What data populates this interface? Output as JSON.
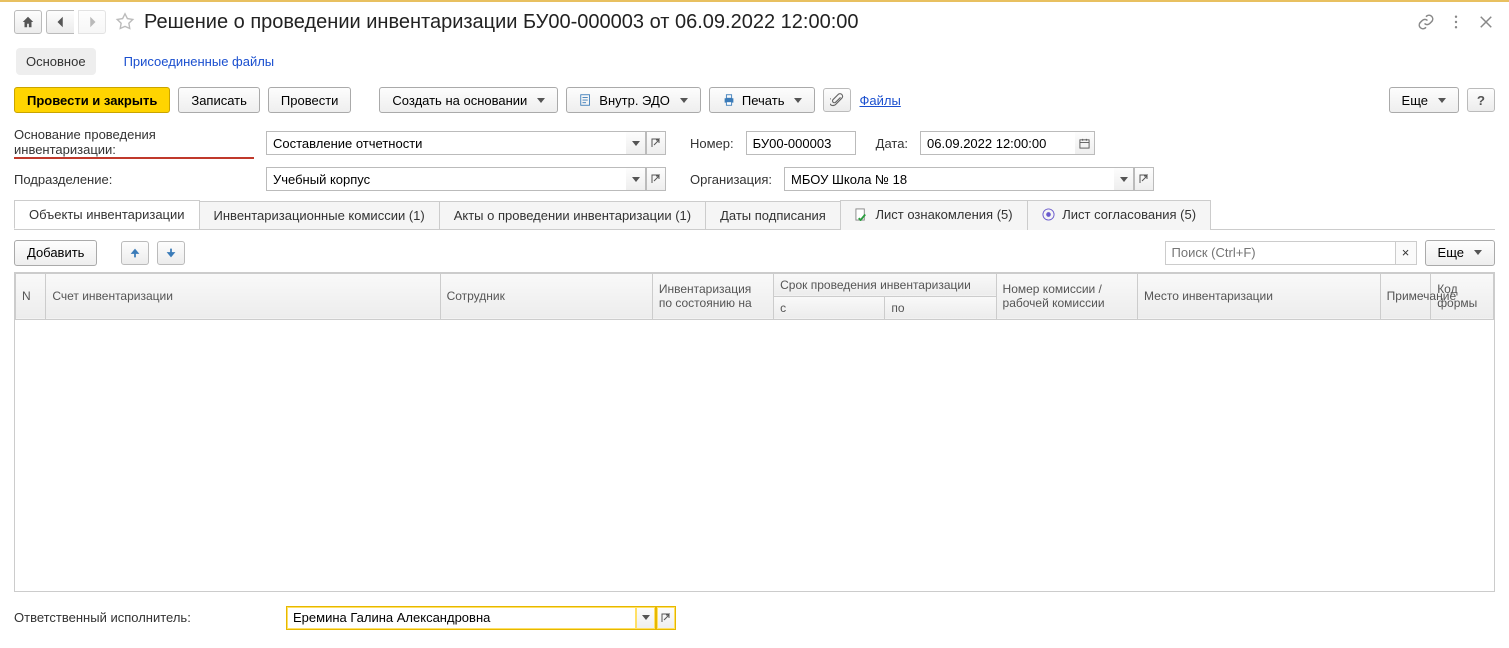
{
  "title": "Решение о проведении инвентаризации БУ00-000003 от 06.09.2022 12:00:00",
  "navTabs": {
    "main": "Основное",
    "files": "Присоединенные файлы"
  },
  "toolbar": {
    "postClose": "Провести и закрыть",
    "save": "Записать",
    "post": "Провести",
    "createBased": "Создать на основании",
    "edo": "Внутр. ЭДО",
    "print": "Печать",
    "filesLink": "Файлы",
    "more": "Еще"
  },
  "form": {
    "basisLabel": "Основание проведения инвентаризации:",
    "basisValue": "Составление отчетности",
    "subdivLabel": "Подразделение:",
    "subdivValue": "Учебный корпус",
    "numberLabel": "Номер:",
    "numberValue": "БУ00-000003",
    "dateLabel": "Дата:",
    "dateValue": "06.09.2022 12:00:00",
    "orgLabel": "Организация:",
    "orgValue": "МБОУ Школа № 18",
    "responsibleLabel": "Ответственный исполнитель:",
    "responsibleValue": "Еремина Галина Александровна"
  },
  "subTabs": {
    "objects": "Объекты инвентаризации",
    "commissions": "Инвентаризационные комиссии (1)",
    "acts": "Акты о проведении инвентаризации (1)",
    "signDates": "Даты подписания",
    "awareness": "Лист ознакомления (5)",
    "approval": "Лист согласования (5)"
  },
  "gridToolbar": {
    "add": "Добавить",
    "searchPlaceholder": "Поиск (Ctrl+F)",
    "more": "Еще"
  },
  "gridColumns": {
    "n": "N",
    "account": "Счет инвентаризации",
    "employee": "Сотрудник",
    "asOf": "Инвентаризация по состоянию на",
    "periodGroup": "Срок проведения инвентаризации",
    "from": "с",
    "to": "по",
    "commission": "Номер комиссии / рабочей комиссии",
    "place": "Место инвентаризации",
    "note": "Примечание",
    "formCode": "Код формы"
  }
}
